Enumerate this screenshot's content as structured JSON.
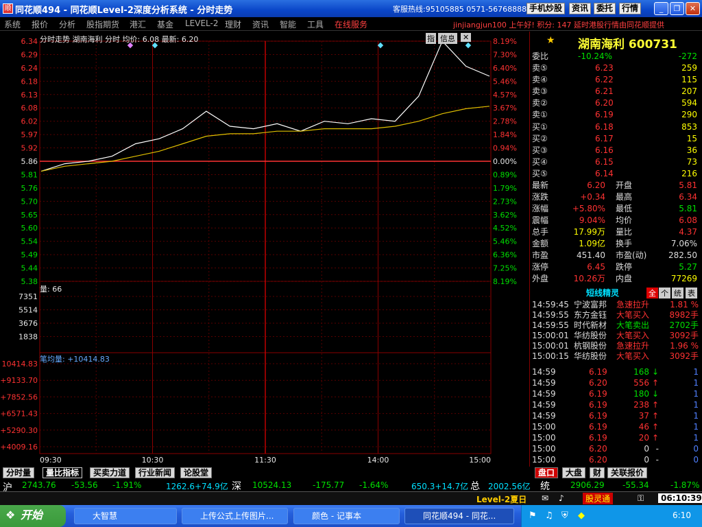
{
  "window": {
    "title": "同花顺494 - 同花顺Level-2深度分析系统 - 分时走势",
    "hotline": "客服热线:95105885 0571-56768888",
    "buttons": [
      "手机炒股",
      "资讯",
      "委托",
      "行情"
    ],
    "app_icon": "app-logo-icon"
  },
  "menu": {
    "items": [
      "系统",
      "报价",
      "分析",
      "股指期货",
      "港汇",
      "基金",
      "LEVEL-2",
      "理财",
      "资讯",
      "智能",
      "工具",
      "在线服务"
    ],
    "greeting": "jinjiangjun100 上午好! 积分: 147 延时港股行情由同花顺提供"
  },
  "chart": {
    "header": "分时走势 湖南海利 分时 均价: 6.08 最新: 6.20",
    "info_btns": [
      "指",
      "信息"
    ],
    "price_ticks": [
      "6.34",
      "6.29",
      "6.24",
      "6.18",
      "6.13",
      "6.08",
      "6.02",
      "5.97",
      "5.92",
      "5.86",
      "5.81",
      "5.76",
      "5.70",
      "5.65",
      "5.60",
      "5.54",
      "5.49",
      "5.44",
      "5.38"
    ],
    "pct_ticks": [
      "8.19%",
      "7.30%",
      "6.40%",
      "5.46%",
      "4.57%",
      "3.67%",
      "2.78%",
      "1.84%",
      "0.94%",
      "0.00%",
      "0.89%",
      "1.79%",
      "2.73%",
      "3.62%",
      "4.52%",
      "5.46%",
      "6.36%",
      "7.25%",
      "8.19%"
    ],
    "vol_label": "量: 66",
    "vol_ticks": [
      "7351",
      "5514",
      "3676",
      "1838"
    ],
    "ind_label": "笔均量: +10414.83",
    "ind_ticks": [
      "10414.83",
      "+9133.70",
      "+7852.56",
      "+6571.43",
      "+5290.30",
      "+4009.16"
    ],
    "time_ticks": [
      "09:30",
      "10:30",
      "11:30",
      "14:00",
      "15:00"
    ]
  },
  "chart_data": {
    "type": "line",
    "title": "湖南海利 分时",
    "ylim": [
      5.38,
      6.34
    ],
    "prev_close": 5.86,
    "x": [
      "09:30",
      "09:45",
      "10:00",
      "10:15",
      "10:30",
      "10:45",
      "11:00",
      "11:15",
      "11:30",
      "13:15",
      "13:30",
      "13:45",
      "14:00",
      "14:15",
      "14:30",
      "14:40",
      "14:45",
      "14:50",
      "14:55",
      "15:00"
    ],
    "series": [
      {
        "values": [
          5.82,
          5.85,
          5.86,
          5.88,
          5.93,
          5.95,
          5.99,
          6.06,
          6.0,
          5.99,
          6.01,
          5.98,
          6.02,
          6.01,
          6.03,
          6.02,
          6.12,
          6.34,
          6.24,
          6.2
        ]
      },
      {
        "values": [
          5.82,
          5.84,
          5.85,
          5.86,
          5.88,
          5.9,
          5.93,
          5.96,
          5.97,
          5.97,
          5.98,
          5.98,
          5.99,
          5.99,
          5.99,
          6.0,
          6.02,
          6.05,
          6.07,
          6.08
        ]
      }
    ]
  },
  "right": {
    "stock_title": "湖南海利 600731",
    "weibi": {
      "label": "委比",
      "pct": "-10.24%",
      "diff": "-272"
    },
    "asks": [
      {
        "l": "卖⑤",
        "p": "6.23",
        "v": "259"
      },
      {
        "l": "卖④",
        "p": "6.22",
        "v": "115"
      },
      {
        "l": "卖③",
        "p": "6.21",
        "v": "207"
      },
      {
        "l": "卖②",
        "p": "6.20",
        "v": "594"
      },
      {
        "l": "卖①",
        "p": "6.19",
        "v": "290"
      }
    ],
    "bids": [
      {
        "l": "买①",
        "p": "6.18",
        "v": "853"
      },
      {
        "l": "买②",
        "p": "6.17",
        "v": "15"
      },
      {
        "l": "买③",
        "p": "6.16",
        "v": "36"
      },
      {
        "l": "买④",
        "p": "6.15",
        "v": "73"
      },
      {
        "l": "买⑤",
        "p": "6.14",
        "v": "216"
      }
    ],
    "stats": [
      [
        "最新",
        "6.20",
        "开盘",
        "5.81"
      ],
      [
        "涨跌",
        "+0.34",
        "最高",
        "6.34"
      ],
      [
        "涨幅",
        "+5.80%",
        "最低",
        "5.81"
      ],
      [
        "震幅",
        "9.04%",
        "均价",
        "6.08"
      ],
      [
        "总手",
        "17.99万",
        "量比",
        "4.37"
      ],
      [
        "金额",
        "1.09亿",
        "换手",
        "7.06%"
      ],
      [
        "市盈",
        "451.40",
        "市盈(动)",
        "282.50"
      ],
      [
        "涨停",
        "6.45",
        "跌停",
        "5.27"
      ],
      [
        "外盘",
        "10.26万",
        "内盘",
        "77269"
      ]
    ],
    "sprite_title": "短线精灵",
    "sprite_tabs": [
      "全",
      "个",
      "统",
      "表"
    ],
    "sprites": [
      [
        "14:59:45",
        "宁波富邦",
        "急速拉升",
        "1.81 %"
      ],
      [
        "14:59:55",
        "东方金钰",
        "大笔买入",
        "8982手"
      ],
      [
        "14:59:55",
        "时代新材",
        "大笔卖出",
        "2702手"
      ],
      [
        "15:00:01",
        "华纺股份",
        "大笔买入",
        "3092手"
      ],
      [
        "15:00:01",
        "杭钢股份",
        "急速拉升",
        "1.96 %"
      ],
      [
        "15:00:15",
        "华纺股份",
        "大笔买入",
        "3092手"
      ]
    ],
    "ticks": [
      [
        "14:59",
        "6.19",
        "168",
        "↓",
        "1"
      ],
      [
        "14:59",
        "6.20",
        "556",
        "↑",
        "1"
      ],
      [
        "14:59",
        "6.19",
        "180",
        "↓",
        "1"
      ],
      [
        "14:59",
        "6.19",
        "238",
        "↑",
        "1"
      ],
      [
        "14:59",
        "6.19",
        "37",
        "↑",
        "1"
      ],
      [
        "15:00",
        "6.19",
        "46",
        "↑",
        "1"
      ],
      [
        "15:00",
        "6.19",
        "20",
        "↑",
        "1"
      ],
      [
        "15:00",
        "6.20",
        "0",
        "-",
        "0"
      ],
      [
        "15:00",
        "6.20",
        "0",
        "-",
        "0"
      ]
    ],
    "tabs": [
      "盘口",
      "大盘",
      "财",
      "关联报价"
    ]
  },
  "bottom_tabs": [
    "分时量",
    "量比指标",
    "买卖力道",
    "行业新闻",
    "论股堂"
  ],
  "index": {
    "sh_name": "沪",
    "sh": "2743.76",
    "sh_chg": "-53.56",
    "sh_pct": "-1.91%",
    "sh_amt": "1262.6+74.9亿",
    "sz_name": "深",
    "sz": "10524.13",
    "sz_chg": "-175.77",
    "sz_pct": "-1.64%",
    "sz_amt": "650.3+14.7亿",
    "tot": "总",
    "tot_amt": "2002.56亿",
    "hs_name": "统",
    "hs": "2906.29",
    "hs_chg": "-55.34",
    "hs_pct": "-1.87%"
  },
  "status": {
    "level2": "Level-2夏日",
    "promo": "股灵通",
    "time": "06:10:39"
  },
  "taskbar": {
    "start": "开始",
    "tasks": [
      "大智慧",
      "上传公式上传图片...",
      "颜色 - 记事本",
      "同花顺494 - 同花..."
    ],
    "clock": "6:10"
  }
}
